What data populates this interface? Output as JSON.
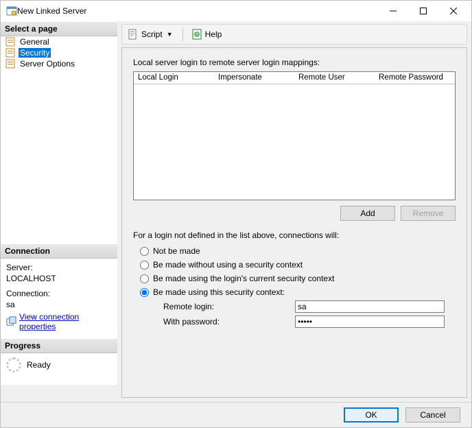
{
  "window": {
    "title": "New Linked Server"
  },
  "sidebar": {
    "select_page_header": "Select a page",
    "pages": [
      {
        "label": "General"
      },
      {
        "label": "Security"
      },
      {
        "label": "Server Options"
      }
    ],
    "connection_header": "Connection",
    "server_label": "Server:",
    "server_value": "LOCALHOST",
    "connection_label": "Connection:",
    "connection_value": "sa",
    "view_props": "View connection properties",
    "progress_header": "Progress",
    "progress_status": "Ready"
  },
  "toolbar": {
    "script": "Script",
    "help": "Help"
  },
  "main": {
    "mappings_label": "Local server login to remote server login mappings:",
    "columns": {
      "local_login": "Local Login",
      "impersonate": "Impersonate",
      "remote_user": "Remote User",
      "remote_password": "Remote Password"
    },
    "add": "Add",
    "remove": "Remove",
    "fallback_label": "For a login not defined in the list above, connections will:",
    "radios": {
      "not_made": "Not be made",
      "no_context": "Be made without using a security context",
      "current_context": "Be made using the login's current security context",
      "this_context": "Be made using this security context:"
    },
    "remote_login_label": "Remote login:",
    "remote_login_value": "sa",
    "with_password_label": "With password:",
    "with_password_value": "•••••"
  },
  "footer": {
    "ok": "OK",
    "cancel": "Cancel"
  }
}
